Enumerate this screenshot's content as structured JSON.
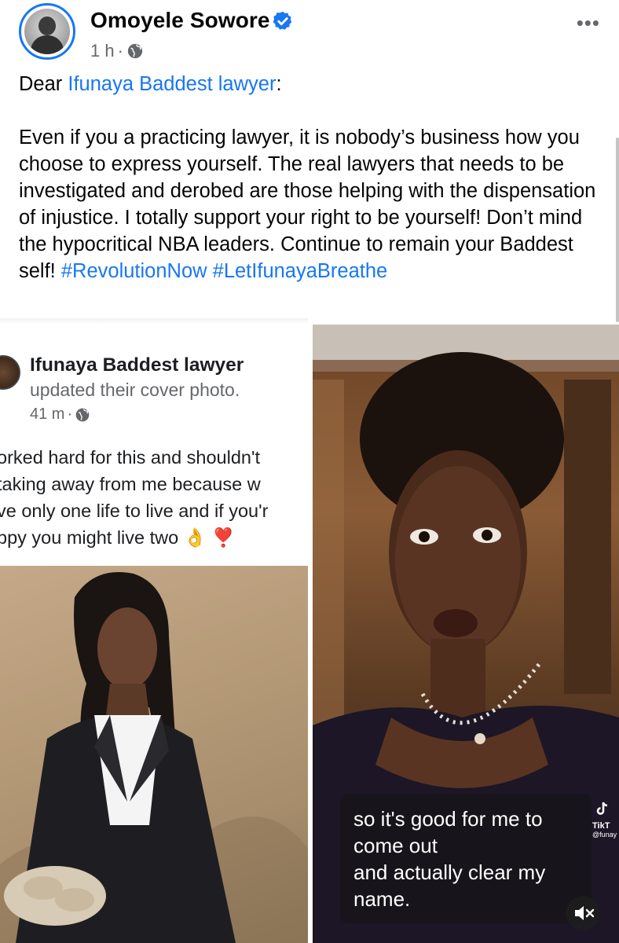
{
  "post": {
    "author": "Omoyele Sowore",
    "time": "1 h",
    "dot": "·",
    "greeting_prefix": "Dear ",
    "greeting_link": "Ifunaya Baddest lawyer",
    "greeting_suffix": ":",
    "body": "Even if you a practicing lawyer, it is nobody’s business how you choose to express yourself. The real lawyers that needs to be investigated and derobed are those helping with the dispensation of injustice. I totally support your right to be yourself! Don’t mind the hypocritical NBA leaders. Continue to remain your Baddest self! ",
    "hashtag1": "#RevolutionNow",
    "hashtag2": "#LetIfunayaBreathe",
    "more_label": "•••"
  },
  "shared_post": {
    "name": "Ifunaya Baddest lawyer",
    "action": "updated their cover photo.",
    "time": "41 m",
    "dot": "·",
    "lines": [
      "orked hard for this and shouldn't",
      "taking away from me because w",
      "ve only one life to live and if you'r",
      "ppy you might live two 👌 ❣️"
    ]
  },
  "video": {
    "caption_lines": [
      "so it's good for me to",
      "come out",
      "and actually clear my",
      "name."
    ],
    "watermark_brand": "TikT",
    "watermark_user": "@funay"
  },
  "colors": {
    "link": "#1877f2",
    "secondary_text": "#65676b",
    "verified": "#1877f2"
  }
}
